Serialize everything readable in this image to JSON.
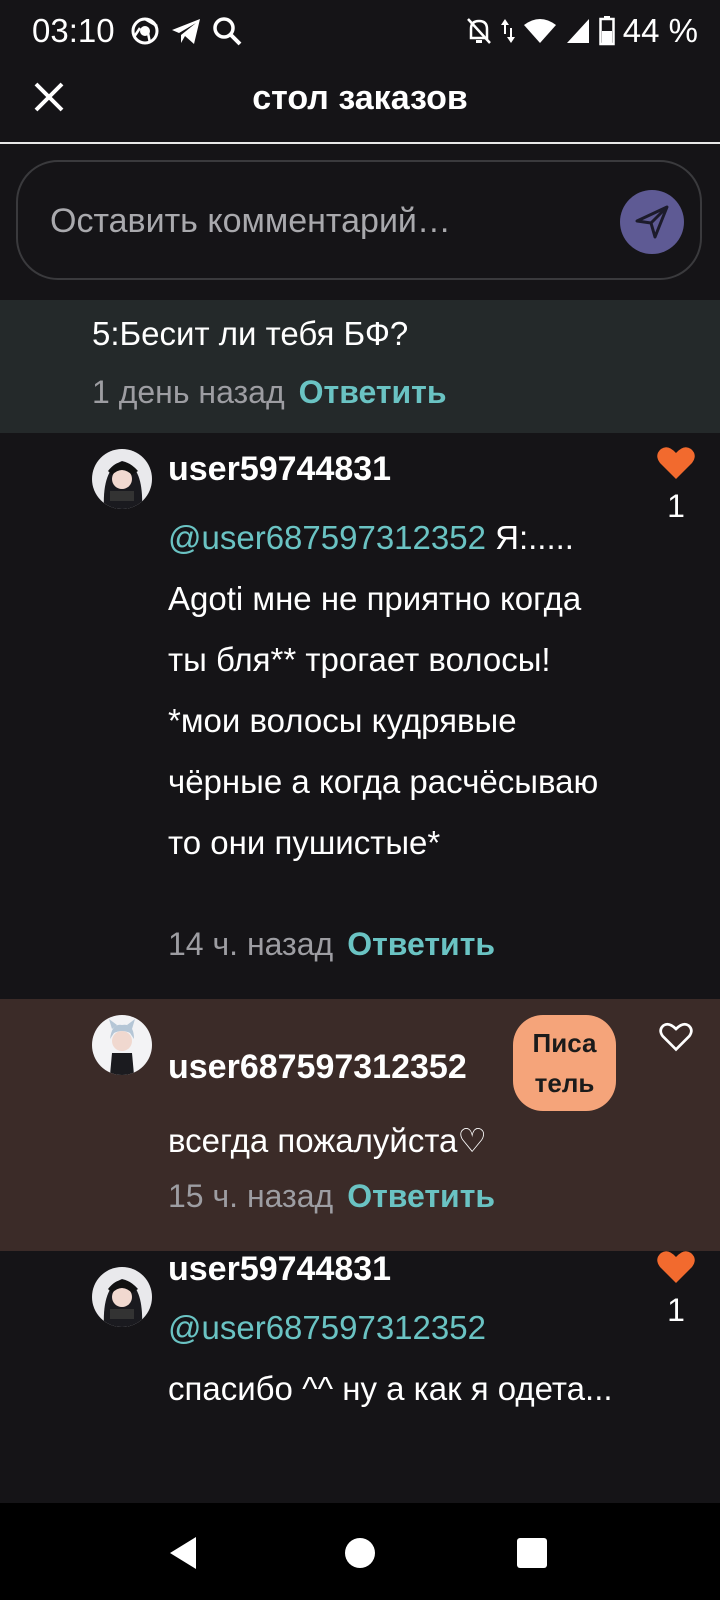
{
  "status_bar": {
    "time": "03:10",
    "left_icons": [
      "chrome-icon",
      "telegram-icon",
      "search-icon"
    ],
    "right_icons": [
      "mute-icon",
      "data-arrows-icon",
      "wifi-icon",
      "signal-icon",
      "battery-icon"
    ],
    "battery": "44 %"
  },
  "header": {
    "title": "стол заказов"
  },
  "comment_input": {
    "placeholder": "Оставить комментарий…",
    "value": ""
  },
  "parent_comment": {
    "text": "5:Бесит ли тебя БФ?",
    "time": "1 день назад",
    "reply_label": "Ответить"
  },
  "replies": [
    {
      "username": "user59744831",
      "mention": "@user687597312352",
      "text": " Я:..... Agoti мне не приятно когда ты бля** трогает волосы! *мои волосы кудрявые чёрные а когда расчёсываю то они пушистые*",
      "time": "14 ч. назад",
      "reply_label": "Ответить",
      "liked": true,
      "like_count": "1"
    },
    {
      "username": "user687597312352",
      "badge": "Писа тель",
      "text": "всегда пожалуйста♡",
      "time": "15 ч. назад",
      "reply_label": "Ответить",
      "liked": false
    },
    {
      "username": "user59744831",
      "mention": "@user687597312352",
      "text": "спасибо ^^ ну а как я одета...",
      "liked": true,
      "like_count": "1"
    }
  ],
  "colors": {
    "background": "#151417",
    "accent_teal": "#6ac3c3",
    "like_orange": "#f26a2e",
    "badge": "#f5a47a",
    "author_highlight": "#3b2b28",
    "send_button": "#5e5a94"
  }
}
